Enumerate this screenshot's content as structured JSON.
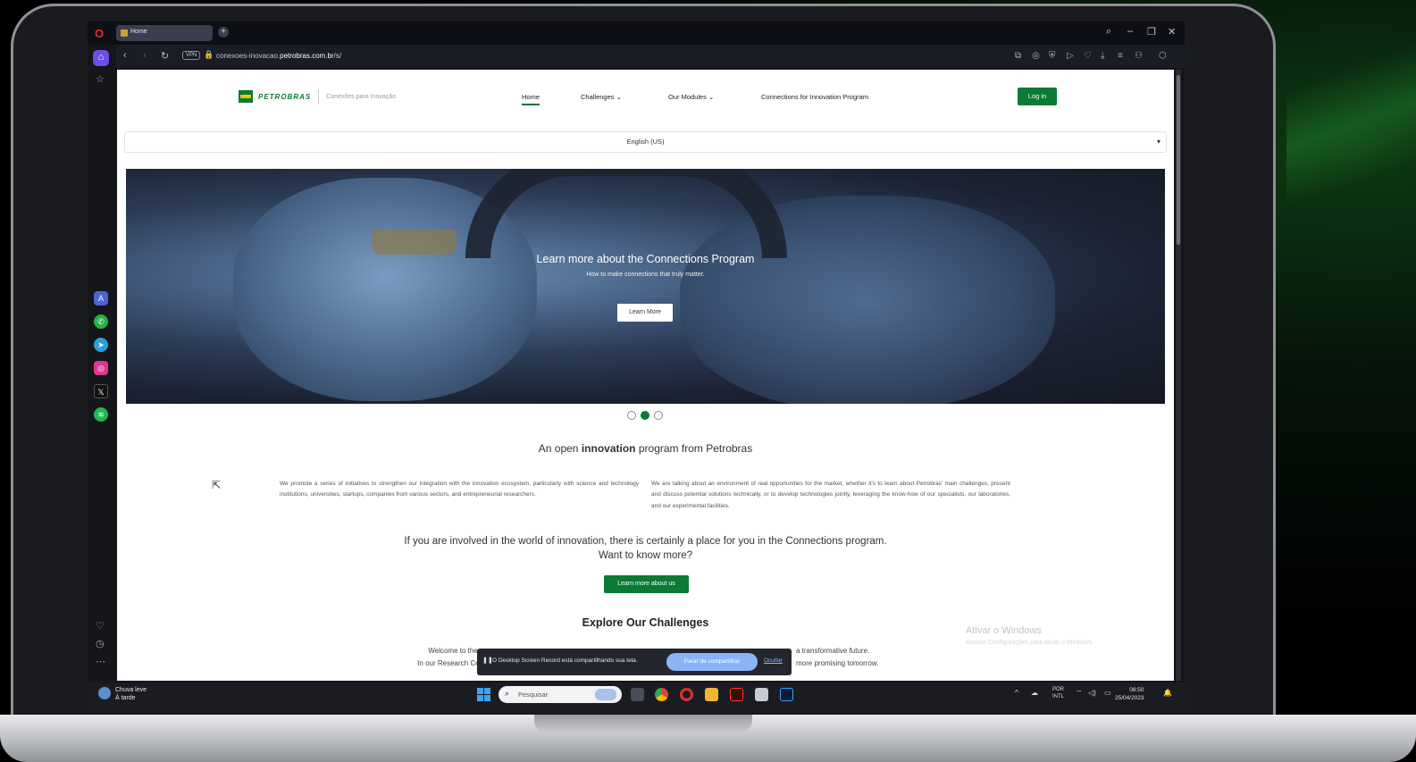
{
  "browser": {
    "tab_title": "Home",
    "new_tab": "+",
    "url_prefix": "conexoes-inovacao.",
    "url_domain": "petrobras.com.br",
    "url_suffix": "/s/",
    "vpn_label": "VPN"
  },
  "site": {
    "brand": "PETROBRAS",
    "brand_subtitle": "Conexões para Inovação",
    "nav": {
      "home": "Home",
      "challenges": "Challenges",
      "modules": "Our Modules",
      "program": "Connections for Innovation Program"
    },
    "login": "Log in",
    "language": "English (US)"
  },
  "hero": {
    "title": "Learn more about the Connections Program",
    "subtitle": "How to make connections that truly matter.",
    "button": "Learn More",
    "active_slide": 2,
    "slide_count": 3
  },
  "intro": {
    "prefix": "An open",
    "highlight": "innovation",
    "suffix": "program from Petrobras",
    "para_left": "We promote a series of initiatives to strengthen our integration with the innovation ecosystem, particularly with science and technology institutions, universities, startups, companies from various sectors, and entrepreneurial researchers.",
    "para_right": "We are talking about an environment of real opportunities for the market, whether it's to learn about Petrobras' main challenges, present and discuss potential solutions technically, or to develop technologies jointly, leveraging the know-how of our specialists, our laboratories, and our experimental facilities."
  },
  "cta": {
    "line1": "If you are involved in the world of innovation, there is certainly a place for you in the Connections program.",
    "line2": "Want to know more?",
    "button": "Learn more about us"
  },
  "explore": {
    "title": "Explore Our Challenges",
    "left_line1": "Welcome to the v",
    "left_line2": "In our Research Cen",
    "right_line1": "a transformative future.",
    "right_line2": "more promising tomorrow."
  },
  "windows_activation": {
    "title": "Ativar o Windows",
    "subtitle": "Acesse Configurações para ativar o Windows."
  },
  "share_bar": {
    "message": "O Desktop Screen Record está compartilhando sua tela.",
    "stop": "Parar de compartilhar",
    "hide": "Ocultar"
  },
  "taskbar": {
    "weather_line1": "Chuva leve",
    "weather_line2": "À tarde",
    "search_placeholder": "Pesquisar",
    "lang_line1": "POR",
    "lang_line2": "INTL",
    "time": "08:50",
    "date": "25/04/2023"
  },
  "colors": {
    "brand_green": "#0a7a35",
    "brand_yellow": "#f2c500",
    "opera_red": "#e0312b",
    "share_blue": "#8ab4f8"
  },
  "icons": {
    "sidebar": [
      "home-icon",
      "star-icon",
      "aria-icon",
      "whatsapp-icon",
      "telegram-icon",
      "instagram-icon",
      "x-icon",
      "spotify-icon",
      "heart-icon",
      "history-icon",
      "more-icon"
    ]
  }
}
